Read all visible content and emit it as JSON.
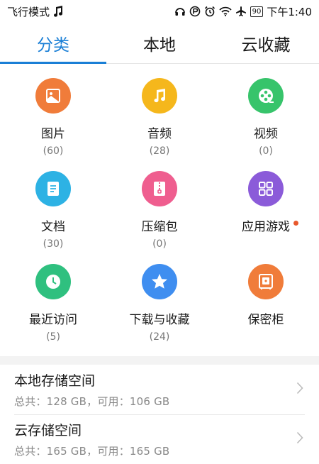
{
  "status_bar": {
    "left_text": "飞行模式",
    "battery": "90",
    "time": "下午1:40",
    "icons": [
      "music-note-icon",
      "headphone-icon",
      "data-saver-icon",
      "alarm-icon",
      "wifi-icon",
      "airplane-icon",
      "battery-icon"
    ]
  },
  "tabs": [
    {
      "label": "分类",
      "active": true
    },
    {
      "label": "本地",
      "active": false
    },
    {
      "label": "云收藏",
      "active": false
    }
  ],
  "categories": [
    {
      "label": "图片",
      "count": "(60)",
      "color": "#f07c3a",
      "icon": "image-icon"
    },
    {
      "label": "音频",
      "count": "(28)",
      "color": "#f5b71c",
      "icon": "music-icon"
    },
    {
      "label": "视频",
      "count": "(0)",
      "color": "#37c46b",
      "icon": "film-reel-icon"
    },
    {
      "label": "文档",
      "count": "(30)",
      "color": "#2db2e4",
      "icon": "document-icon"
    },
    {
      "label": "压缩包",
      "count": "(0)",
      "color": "#ef5e8f",
      "icon": "zip-icon"
    },
    {
      "label": "应用游戏",
      "count": "",
      "color": "#8b5bd9",
      "icon": "apps-grid-icon",
      "badge_dot": true
    },
    {
      "label": "最近访问",
      "count": "(5)",
      "color": "#2fc07f",
      "icon": "clock-icon"
    },
    {
      "label": "下载与收藏",
      "count": "(24)",
      "color": "#3f8ef0",
      "icon": "star-icon"
    },
    {
      "label": "保密柜",
      "count": "",
      "color": "#f07c3a",
      "icon": "safe-icon"
    }
  ],
  "storage": [
    {
      "title": "本地存储空间",
      "info": "总共：128 GB，可用：106 GB"
    },
    {
      "title": "云存储空间",
      "info": "总共：165 GB，可用：165 GB"
    }
  ]
}
